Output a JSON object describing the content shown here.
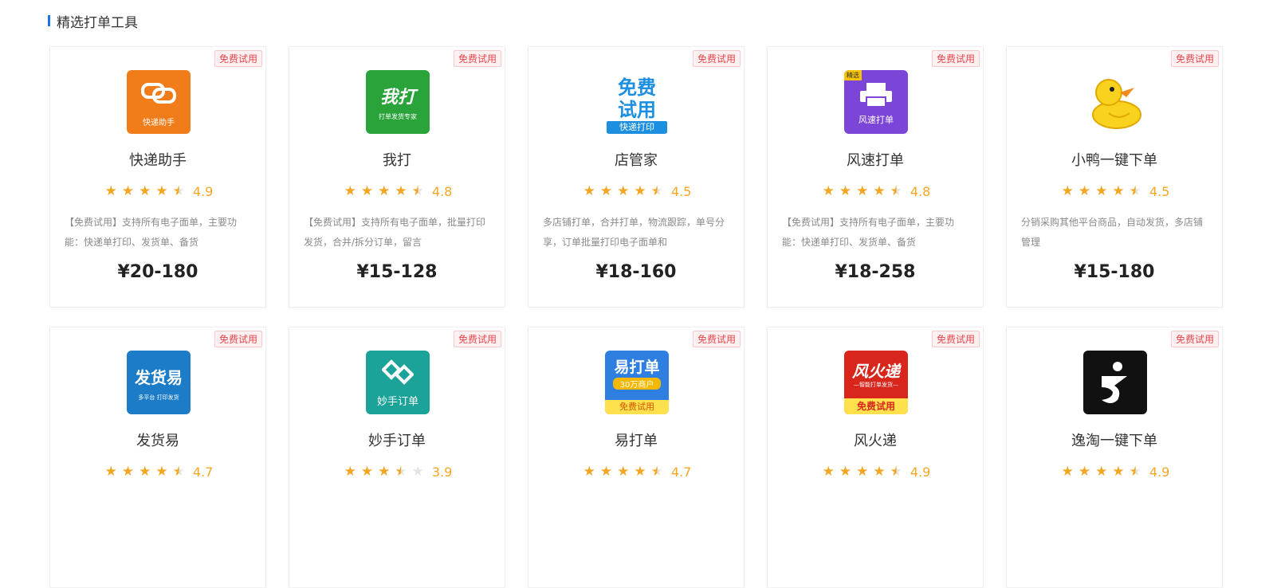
{
  "section": {
    "title": "精选打单工具"
  },
  "badge_label": "免费试用",
  "colors": {
    "accent": "#1a73e8",
    "star": "#f4a623",
    "badge": "#e5454b"
  },
  "tools": [
    {
      "name": "快递助手",
      "rating": 4.9,
      "rating_text": "4.9",
      "desc": "【免费试用】支持所有电子面单，主要功能：快递单打印、发货单、备货",
      "price": "¥20-180",
      "logo": {
        "icon": "kuaidi-zhushou-logo",
        "bg": "#f07d19",
        "lines": [
          "快递助手"
        ]
      }
    },
    {
      "name": "我打",
      "rating": 4.8,
      "rating_text": "4.8",
      "desc": "【免费试用】支持所有电子面单，批量打印发货，合并/拆分订单，留言",
      "price": "¥15-128",
      "logo": {
        "icon": "woda-logo",
        "bg": "#2aa33a",
        "lines": [
          "我打",
          "打单发货专家"
        ]
      }
    },
    {
      "name": "店管家",
      "rating": 4.5,
      "rating_text": "4.5",
      "desc": "多店铺打单，合并打单，物流跟踪，单号分享，订单批量打印电子面单和",
      "price": "¥18-160",
      "logo": {
        "icon": "dianguanjia-logo",
        "bg": "#ffffff",
        "lines": [
          "免费",
          "试用",
          "快递打印"
        ]
      }
    },
    {
      "name": "风速打单",
      "rating": 4.8,
      "rating_text": "4.8",
      "desc": "【免费试用】支持所有电子面单，主要功能：快递单打印、发货单、备货",
      "price": "¥18-258",
      "logo": {
        "icon": "printer-icon",
        "bg": "#7b45d8",
        "lines": [
          "风速打单"
        ],
        "corner": "精选"
      }
    },
    {
      "name": "小鸭一键下单",
      "rating": 4.5,
      "rating_text": "4.5",
      "desc": "分销采购其他平台商品，自动发货，多店铺管理",
      "price": "¥15-180",
      "logo": {
        "icon": "duck-icon",
        "bg": "#ffffff",
        "lines": []
      }
    },
    {
      "name": "发货易",
      "rating": 4.7,
      "rating_text": "4.7",
      "desc": "",
      "price": "",
      "logo": {
        "icon": "fahuoyi-logo",
        "bg": "#1c7cc7",
        "lines": [
          "发货易",
          "多平台 打印发货"
        ]
      }
    },
    {
      "name": "妙手订单",
      "rating": 3.9,
      "rating_text": "3.9",
      "desc": "",
      "price": "",
      "logo": {
        "icon": "miaoshou-logo",
        "bg": "#1ba39a",
        "lines": [
          "妙手订单"
        ]
      }
    },
    {
      "name": "易打单",
      "rating": 4.7,
      "rating_text": "4.7",
      "desc": "",
      "price": "",
      "logo": {
        "icon": "yidadan-logo",
        "bg": "#2f7fe0",
        "lines": [
          "易打单",
          "30万商户",
          "免费试用"
        ]
      }
    },
    {
      "name": "风火递",
      "rating": 4.9,
      "rating_text": "4.9",
      "desc": "",
      "price": "",
      "logo": {
        "icon": "fenghuodi-logo",
        "bg": "#d8261d",
        "lines": [
          "风火递",
          "—智能打单发货—",
          "免费试用"
        ]
      }
    },
    {
      "name": "逸淘一键下单",
      "rating": 4.9,
      "rating_text": "4.9",
      "desc": "",
      "price": "",
      "logo": {
        "icon": "yitao-logo",
        "bg": "#111111",
        "lines": []
      }
    }
  ]
}
